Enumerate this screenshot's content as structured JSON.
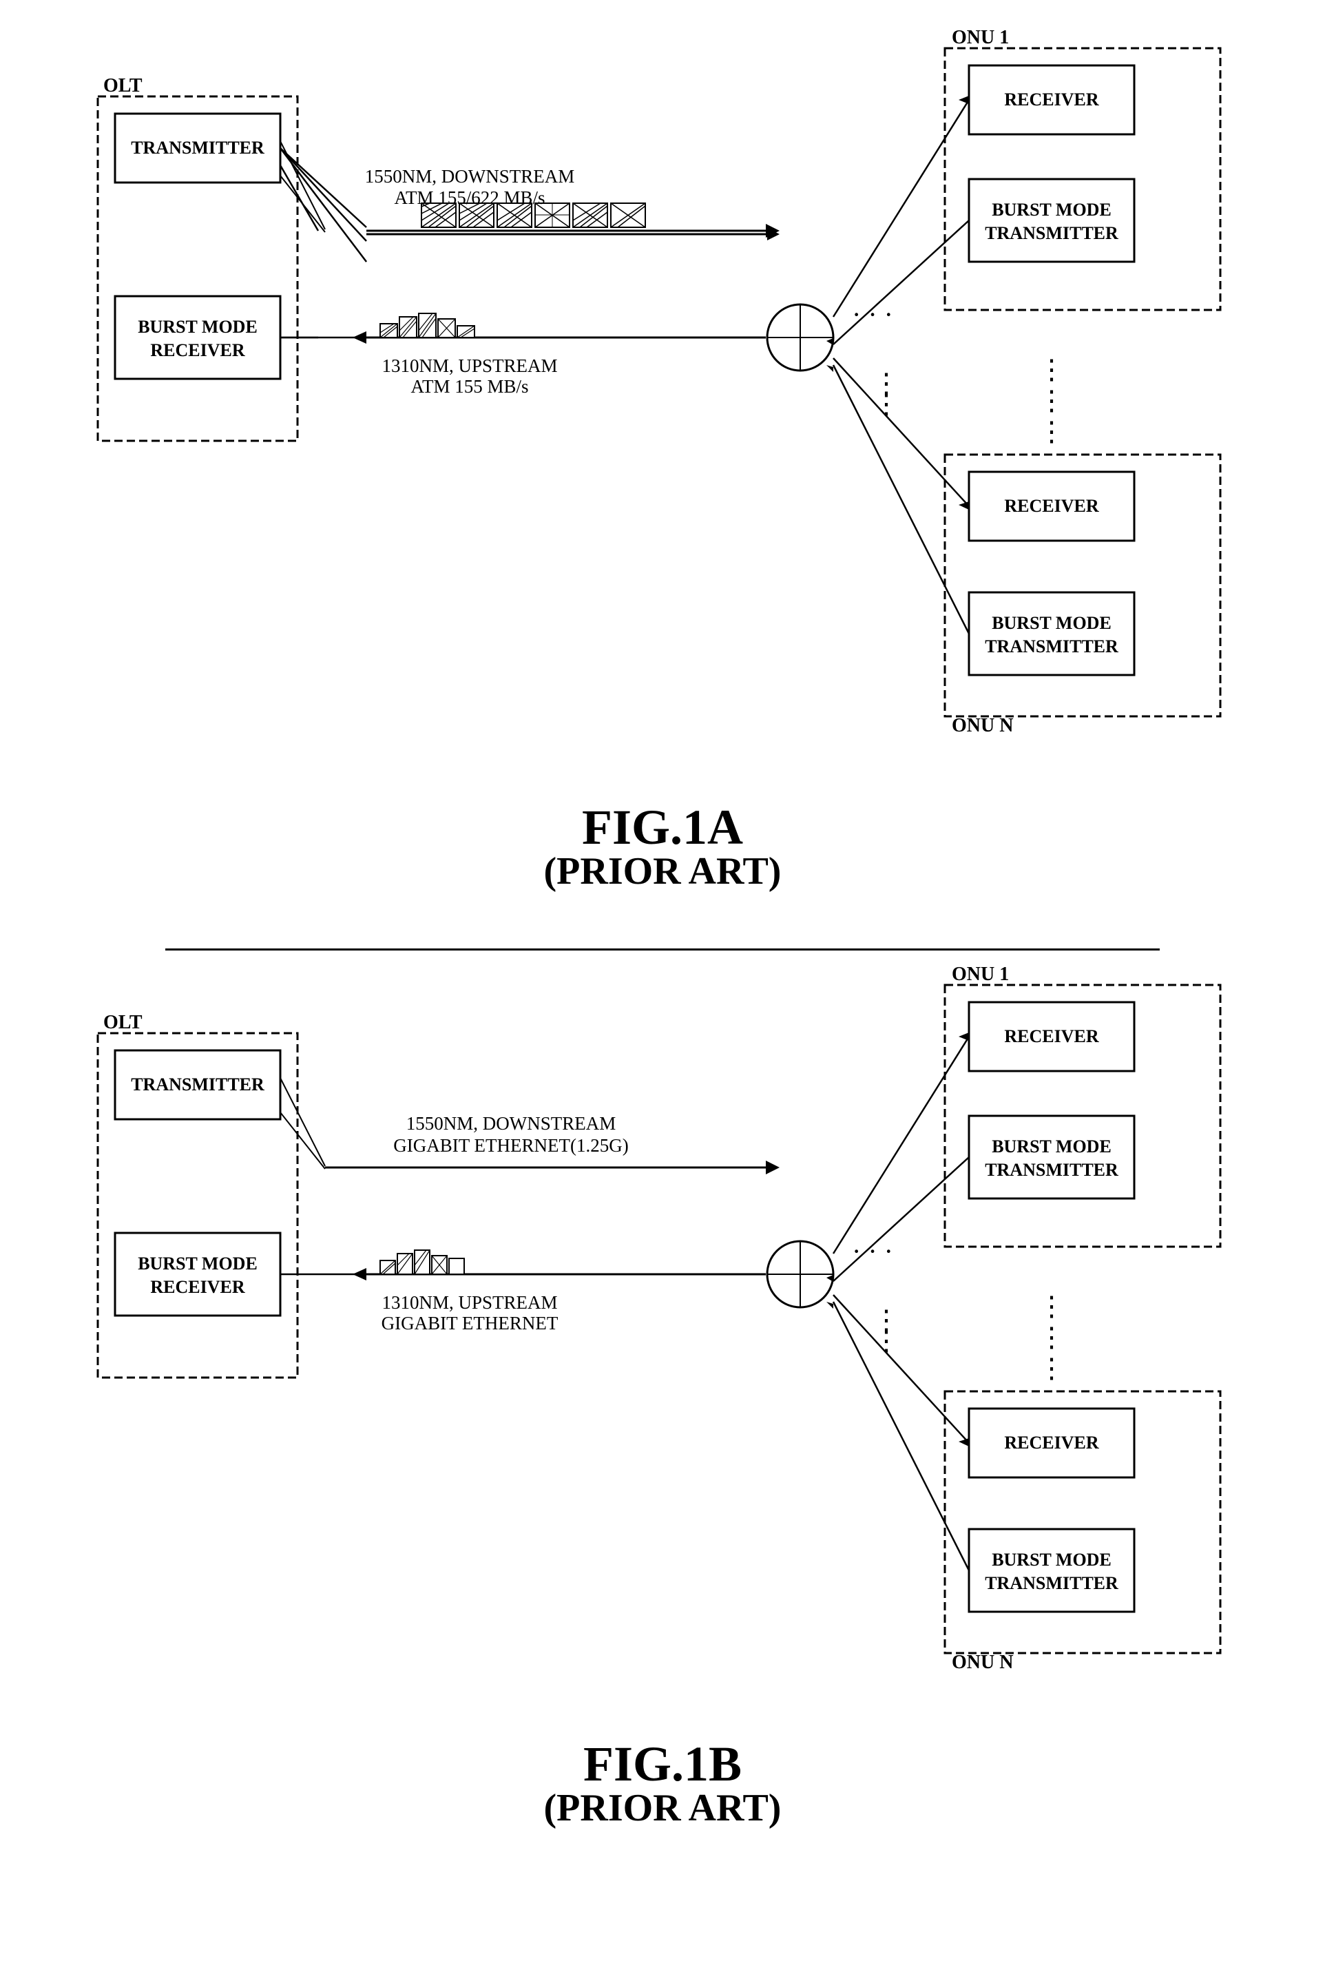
{
  "diagrams": [
    {
      "id": "fig1a",
      "caption_number": "FIG.1A",
      "caption_sub": "(PRIOR ART)",
      "olt_label": "OLT",
      "onu1_label": "ONU 1",
      "onuN_label": "ONU N",
      "transmitter_label": "TRANSMITTER",
      "burst_mode_receiver_label": "BURST MODE\nRECEIVER",
      "receiver1_label": "RECEIVER",
      "burst_mode_tx1_label": "BURST MODE\nTRANSMITTER",
      "receiver2_label": "RECEIVER",
      "burst_mode_tx2_label": "BURST MODE\nTRANSMITTER",
      "downstream_label": "1550NM, DOWNSTREAM\nATM 155/622 MB/s",
      "upstream_label": "1310NM, UPSTREAM\nATM 155 MB/s"
    },
    {
      "id": "fig1b",
      "caption_number": "FIG.1B",
      "caption_sub": "(PRIOR ART)",
      "olt_label": "OLT",
      "onu1_label": "ONU 1",
      "onuN_label": "ONU N",
      "transmitter_label": "TRANSMITTER",
      "burst_mode_receiver_label": "BURST MODE\nRECEIVER",
      "receiver1_label": "RECEIVER",
      "burst_mode_tx1_label": "BURST MODE\nTRANSMITTER",
      "receiver2_label": "RECEIVER",
      "burst_mode_tx2_label": "BURST MODE\nTRANSMITTER",
      "downstream_label": "1550NM, DOWNSTREAM\nGIGABIT ETHERNET(1.25G)",
      "upstream_label": "1310NM, UPSTREAM\nGIGABIT ETHERNET"
    }
  ]
}
